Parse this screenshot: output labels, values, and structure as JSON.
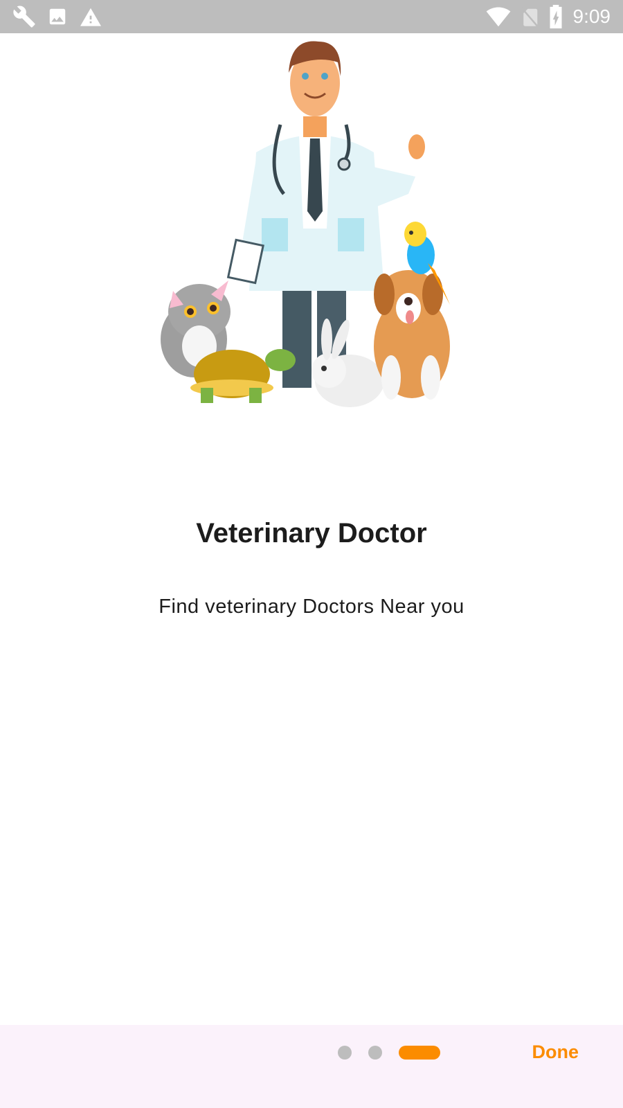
{
  "status_bar": {
    "time": "9:09",
    "left_icons": [
      "wrench-icon",
      "image-icon",
      "warning-icon"
    ],
    "right_icons": [
      "wifi-icon",
      "no-sim-icon",
      "battery-charging-icon"
    ]
  },
  "onboarding": {
    "title": "Veterinary Doctor",
    "subtitle": "Find veterinary Doctors Near you",
    "page_indicator": {
      "total": 3,
      "current": 3
    },
    "done_label": "Done"
  },
  "colors": {
    "accent": "#fb8c00",
    "inactive_dot": "#bdbdbd",
    "status_bar": "#bdbdbd",
    "bottom_bar": "#fbf2fb",
    "text": "#1c1c1c"
  }
}
